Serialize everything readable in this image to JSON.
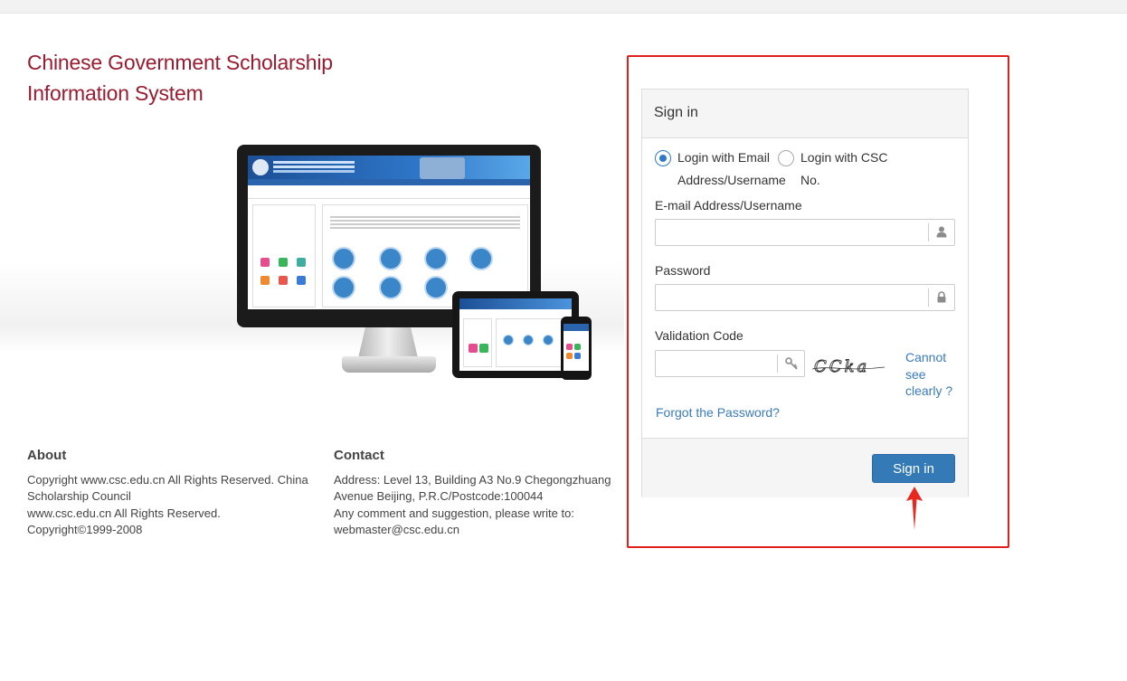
{
  "brand": {
    "title_line1": "Chinese Government Scholarship",
    "title_line2": "Information System"
  },
  "about": {
    "heading": "About",
    "lines": [
      "Copyright www.csc.edu.cn All Rights Reserved. China",
      "Scholarship Council",
      "www.csc.edu.cn All Rights Reserved.",
      "Copyright©1999-2008"
    ]
  },
  "contact": {
    "heading": "Contact",
    "lines": [
      "Address: Level 13, Building A3 No.9 Chegongzhuang",
      "Avenue Beijing, P.R.C/Postcode:100044",
      "Any comment and suggestion, please write to:",
      "webmaster@csc.edu.cn"
    ]
  },
  "signin": {
    "panel_title": "Sign in",
    "radio_email_line1": "Login with Email",
    "radio_email_line2": "Address/Username",
    "radio_csc_line1": "Login with CSC",
    "radio_csc_line2": "No.",
    "selected_login_type": "email",
    "email_label": "E-mail Address/Username",
    "email_value": "",
    "password_label": "Password",
    "password_value": "",
    "validation_label": "Validation Code",
    "validation_value": "",
    "captcha_text": "CCka",
    "cannot_see_line1": "Cannot",
    "cannot_see_line2": "see",
    "cannot_see_line3": "clearly ?",
    "forgot_password": "Forgot the Password?",
    "submit_label": "Sign in"
  },
  "icons": {
    "email_addon": "user-icon",
    "password_addon": "lock-icon",
    "validation_addon": "key-icon",
    "annotation": "red-arrow-icon"
  },
  "colors": {
    "brand_title": "#9b1b30",
    "primary_button": "#337ab7",
    "link": "#3a7bbd",
    "highlight_frame": "#e1201e"
  }
}
